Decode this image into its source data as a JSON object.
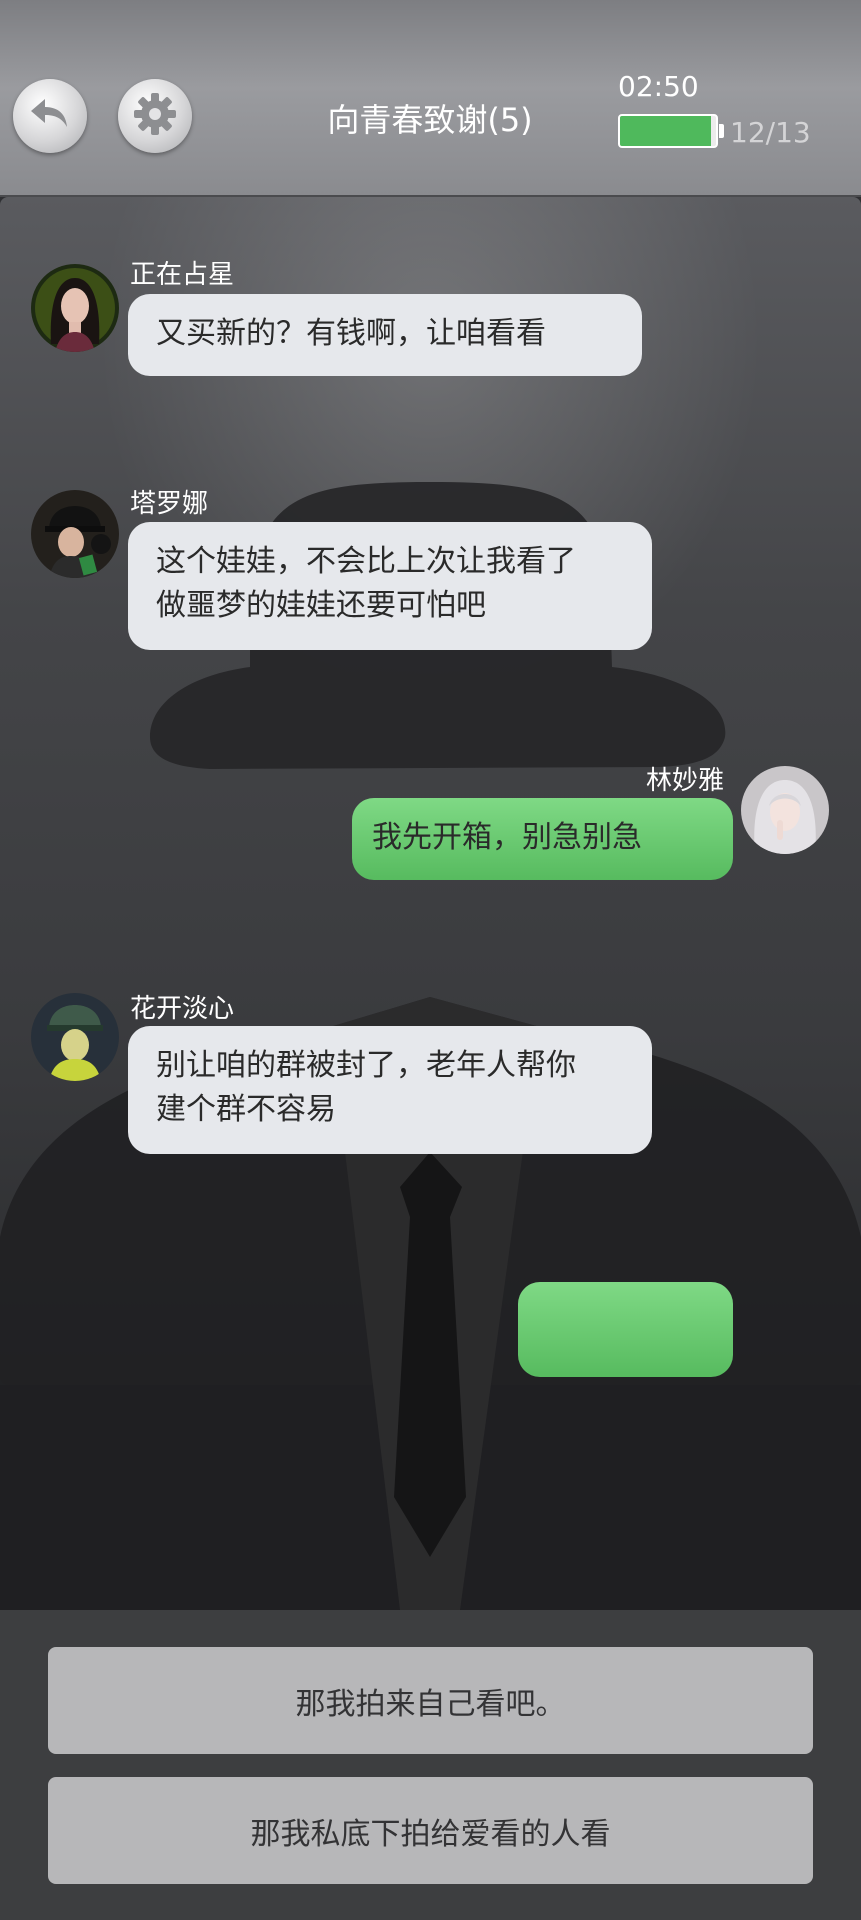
{
  "header": {
    "title": "向青春致谢(5)",
    "timer": "02:50",
    "progress": "12/13",
    "battery_level": 0.95,
    "back_icon": "back-arrow-icon",
    "settings_icon": "gear-icon"
  },
  "messages": [
    {
      "sender": "正在占星",
      "side": "left",
      "text": [
        "又买新的？有钱啊，让咱看看"
      ]
    },
    {
      "sender": "塔罗娜",
      "side": "left",
      "text": [
        "这个娃娃，不会比上次让我看了",
        "做噩梦的娃娃还要可怕吧"
      ]
    },
    {
      "sender": "林妙雅",
      "side": "right",
      "text": [
        "我先开箱，别急别急"
      ]
    },
    {
      "sender": "花开淡心",
      "side": "left",
      "text": [
        "别让咱的群被封了，老年人帮你",
        "建个群不容易"
      ]
    },
    {
      "sender": "",
      "side": "right",
      "text": [
        ""
      ]
    }
  ],
  "choices": [
    {
      "label": "那我拍来自己看吧。"
    },
    {
      "label": "那我私底下拍给爱看的人看"
    }
  ],
  "colors": {
    "outgoing_bubble": "#57bb5f",
    "incoming_bubble": "#e6e8ec",
    "battery": "#4fb95c"
  }
}
